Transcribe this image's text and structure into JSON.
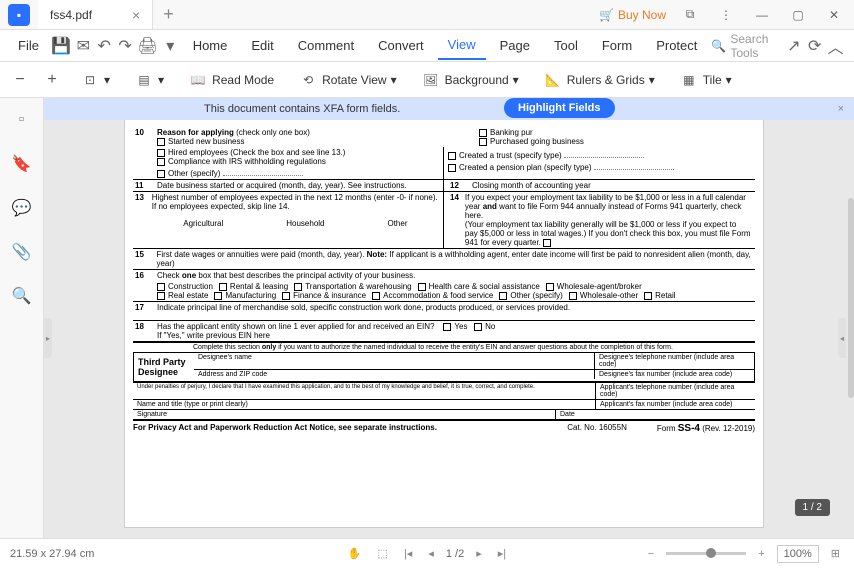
{
  "titlebar": {
    "filename": "fss4.pdf",
    "buy_now": "Buy Now"
  },
  "menu": {
    "file": "File",
    "home": "Home",
    "edit": "Edit",
    "comment": "Comment",
    "convert": "Convert",
    "view": "View",
    "page": "Page",
    "tool": "Tool",
    "form": "Form",
    "protect": "Protect",
    "search_placeholder": "Search Tools"
  },
  "toolbar": {
    "read_mode": "Read Mode",
    "rotate_view": "Rotate View",
    "background": "Background",
    "rulers_grids": "Rulers & Grids",
    "tile": "Tile"
  },
  "banner": {
    "text": "This document contains XFA form fields.",
    "highlight": "Highlight Fields"
  },
  "form": {
    "r10": "10",
    "r10_label": "Reason for applying",
    "r10_hint": "(check only one box)",
    "r10_started": "Started new business",
    "r10_banking": "Banking pur",
    "r10_purchased": "Purchased going business",
    "r10_hired": "Hired employees (Check the box and see line 13.)",
    "r10_trust": "Created a trust (specify type)",
    "r10_compliance": "Compliance with IRS withholding regulations",
    "r10_pension": "Created a pension plan (specify type)",
    "r10_other": "Other (specify)",
    "r11": "11",
    "r11_text": "Date business started or acquired (month, day, year). See instructions.",
    "r12": "12",
    "r12_text": "Closing month of accounting year",
    "r14": "14",
    "r14_text1": "If you expect your employment tax liability to be $1,000 or less in a full calendar year",
    "r14_and": "and",
    "r14_text2": "want to file Form 944 annually instead of Forms 941 quarterly, check here.",
    "r14_text3": "(Your employment tax liability generally will be $1,000 or less if you expect to pay $5,000 or less in total wages.) If you don't check this box, you must file Form 941 for every quarter.",
    "r13": "13",
    "r13_text": "Highest number of employees expected in the next 12 months (enter -0- if none). If no employees expected, skip line 14.",
    "r13_ag": "Agricultural",
    "r13_hh": "Household",
    "r13_other": "Other",
    "r15": "15",
    "r15_text": "First date wages or annuities were paid (month, day, year).",
    "r15_note": "Note:",
    "r15_text2": "If applicant is a withholding agent, enter date income will first be paid to nonresident alien (month, day, year)",
    "r16": "16",
    "r16_text": "Check",
    "r16_one": "one",
    "r16_text2": "box that best describes the principal activity of your business.",
    "r16_construction": "Construction",
    "r16_realestate": "Real estate",
    "r16_rental": "Rental & leasing",
    "r16_manufacturing": "Manufacturing",
    "r16_transport": "Transportation & warehousing",
    "r16_finance": "Finance & insurance",
    "r16_health": "Health care & social assistance",
    "r16_accom": "Accommodation & food service",
    "r16_other2": "Other (specify)",
    "r16_wholesale_broker": "Wholesale-agent/broker",
    "r16_wholesale_other": "Wholesale-other",
    "r16_retail": "Retail",
    "r17": "17",
    "r17_text": "Indicate principal line of merchandise sold, specific construction work done, products produced, or services provided.",
    "r18": "18",
    "r18_text": "Has the applicant entity shown on line 1 ever applied for and received an EIN?",
    "r18_yes": "Yes",
    "r18_no": "No",
    "r18_text2": "If \"Yes,\" write previous EIN here",
    "designee_intro": "Complete this section",
    "designee_only": "only",
    "designee_intro2": "if you want to authorize the named individual to receive the entity's EIN and answer questions about the completion of this form.",
    "designee_title": "Third Party Designee",
    "designee_name": "Designee's name",
    "designee_phone": "Designee's telephone number (include area code)",
    "designee_addr": "Address and ZIP code",
    "designee_fax": "Designee's fax number (include area code)",
    "applicant_phone": "Applicant's telephone number (include area code)",
    "applicant_fax": "Applicant's fax number (include area code)",
    "perjury": "Under penalties of perjury, I declare that I have examined this application, and to the best of my knowledge and belief, it is true, correct, and complete.",
    "name_title": "Name and title (type or print clearly)",
    "signature": "Signature",
    "date": "Date",
    "privacy": "For Privacy Act and Paperwork Reduction Act Notice, see separate instructions.",
    "cat": "Cat. No. 16055N",
    "form_label": "Form",
    "form_num": "SS-4",
    "rev": "(Rev. 12-2019)"
  },
  "page_badge": "1 / 2",
  "status": {
    "dims": "21.59 x 27.94 cm",
    "page": "1 /2",
    "zoom": "100%"
  }
}
